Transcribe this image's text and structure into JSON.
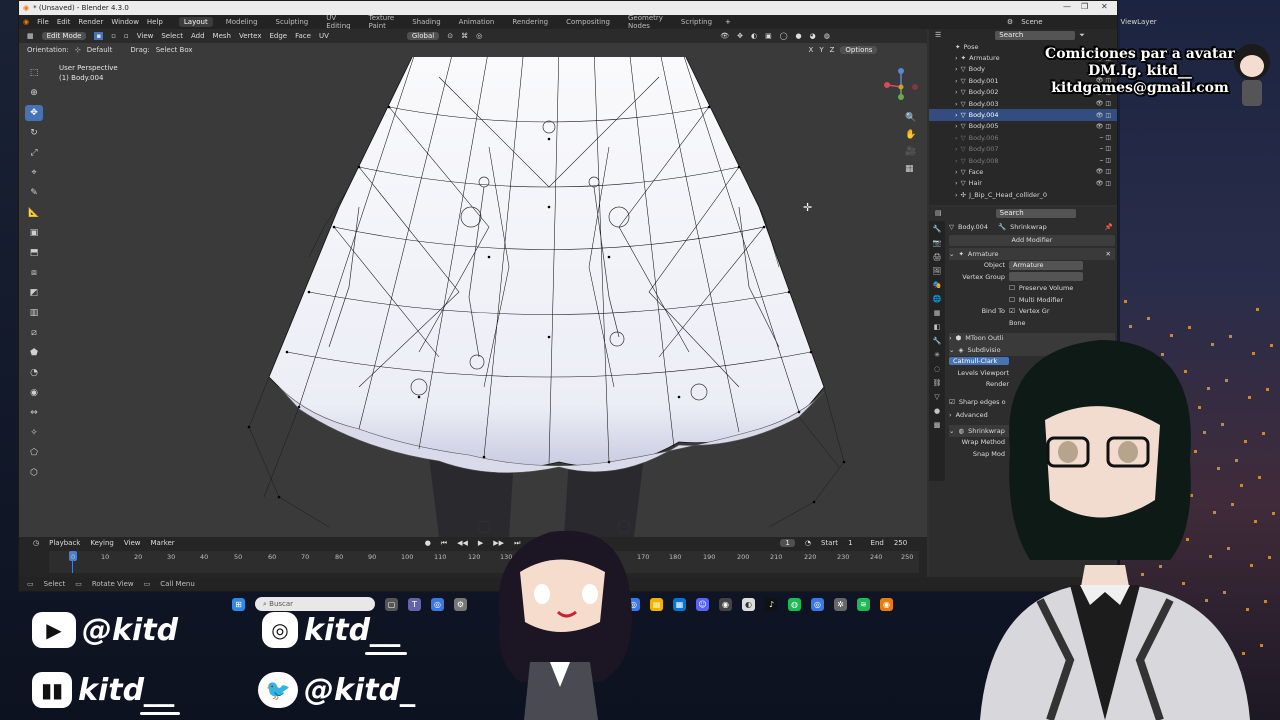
{
  "window": {
    "title": "* (Unsaved) - Blender 4.3.0",
    "controls": [
      "—",
      "❐",
      "✕"
    ]
  },
  "menubar": {
    "menus": [
      "File",
      "Edit",
      "Render",
      "Window",
      "Help"
    ],
    "workspaces": [
      "Layout",
      "Modeling",
      "Sculpting",
      "UV Editing",
      "Texture Paint",
      "Shading",
      "Animation",
      "Rendering",
      "Compositing",
      "Geometry Nodes",
      "Scripting"
    ],
    "active_workspace": "Layout",
    "scene": "Scene",
    "view_layer": "ViewLayer"
  },
  "viewport": {
    "mode": "Edit Mode",
    "menus": [
      "View",
      "Select",
      "Add",
      "Mesh",
      "Vertex",
      "Edge",
      "Face",
      "UV"
    ],
    "orientation_label": "Orientation:",
    "orientation_value": "Default",
    "drag_label": "Drag:",
    "drag_value": "Select Box",
    "transform": "Global",
    "options_label": "Options",
    "info_line1": "User Perspective",
    "info_line2": "(1) Body.004"
  },
  "timeline": {
    "menus": [
      "Playback",
      "Keying",
      "View",
      "Marker"
    ],
    "current_frame": "1",
    "start_label": "Start",
    "start": "1",
    "end_label": "End",
    "end": "250",
    "ticks": [
      "0",
      "10",
      "20",
      "30",
      "40",
      "50",
      "60",
      "70",
      "80",
      "90",
      "100",
      "110",
      "120",
      "130",
      "170",
      "180",
      "190",
      "200",
      "210",
      "220",
      "230",
      "240",
      "250"
    ]
  },
  "statusbar": {
    "items": [
      "Select",
      "Rotate View",
      "Call Menu"
    ]
  },
  "outliner": {
    "search_placeholder": "Search",
    "items": [
      {
        "name": "Pose",
        "state": "normal"
      },
      {
        "name": "Armature",
        "state": "normal"
      },
      {
        "name": "Body",
        "state": "normal"
      },
      {
        "name": "Body.001",
        "state": "normal"
      },
      {
        "name": "Body.002",
        "state": "normal"
      },
      {
        "name": "Body.003",
        "state": "normal"
      },
      {
        "name": "Body.004",
        "state": "selected"
      },
      {
        "name": "Body.005",
        "state": "normal"
      },
      {
        "name": "Body.006",
        "state": "dim"
      },
      {
        "name": "Body.007",
        "state": "dim"
      },
      {
        "name": "Body.008",
        "state": "dim"
      },
      {
        "name": "Face",
        "state": "normal"
      },
      {
        "name": "Hair",
        "state": "normal"
      },
      {
        "name": "J_Bip_C_Head_collider_0",
        "state": "normal"
      }
    ]
  },
  "properties": {
    "search_placeholder": "Search",
    "object": "Body.004",
    "modifier_context": "Shrinkwrap",
    "add_modifier": "Add Modifier",
    "armature_modifier": "Armature",
    "object_label": "Object",
    "object_value": "Armature",
    "vertex_group_label": "Vertex Group",
    "preserve_volume": "Preserve Volume",
    "multi_modifier": "Multi Modifier",
    "bind_to_label": "Bind To",
    "bind_vertex_groups": "Vertex Gr",
    "bind_bone": "Bone",
    "mtoon_modifier": "MToon Outli",
    "subdivision_modifier": "Subdivisio",
    "subdiv_type": "Catmull-Clark",
    "levels_viewport": "Levels Viewport",
    "render_label": "Render",
    "sharp_edges": "Sharp edges o",
    "advanced": "Advanced",
    "shrinkwrap_modifier": "Shrinkwrap",
    "wrap_method": "Wrap Method",
    "snap_mode": "Snap Mod"
  },
  "taskbar": {
    "search_placeholder": "Buscar"
  },
  "overlay": {
    "banner_line1": "Comiciones par a avatar",
    "banner_line2": "DM.Ig. kitd__",
    "banner_line3": "kitdgames@gmail.com",
    "youtube": "@kitd",
    "instagram": "kitd__",
    "twitch": "kitd__",
    "twitter": "@kitd_"
  },
  "colors": {
    "blender_bg": "#303030",
    "selection_blue": "#4772b3",
    "outliner_selected": "#334d80",
    "timeline_playhead": "#4a7fd0",
    "mesh_white": "#f4f4f8"
  },
  "icons": {
    "youtube": "youtube-icon",
    "instagram": "instagram-icon",
    "twitch": "twitch-icon",
    "twitter": "twitter-icon"
  }
}
